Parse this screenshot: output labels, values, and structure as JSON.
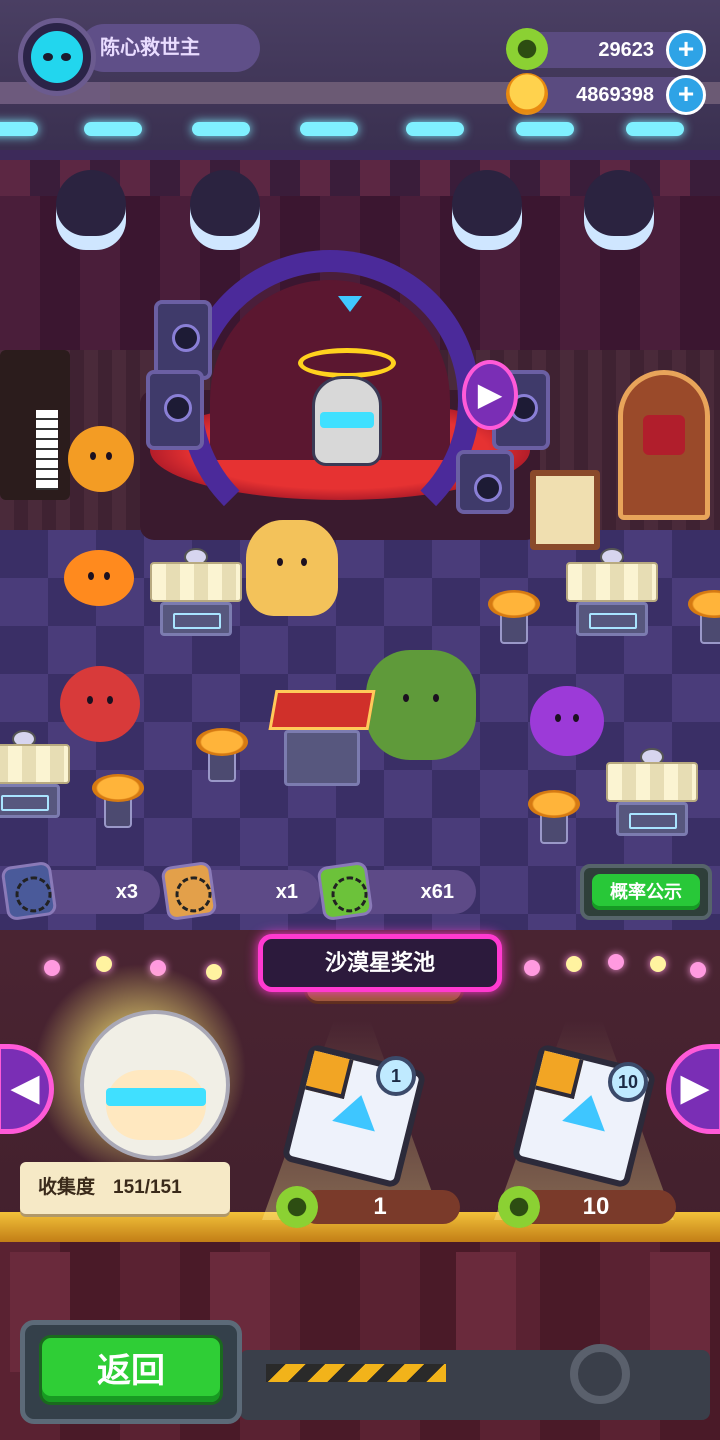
{
  "player": {
    "name": "陈心救世主",
    "avatar_icon": "cat-face-icon",
    "avatar_color": "#22d6ee"
  },
  "currencies": [
    {
      "icon": "green-gear-token-icon",
      "amount": "29623"
    },
    {
      "icon": "golden-planet-coin-icon",
      "amount": "4869398"
    }
  ],
  "inventory": [
    {
      "icon": "blue-bottle-cap-icon",
      "count": "x3"
    },
    {
      "icon": "orange-bottle-cap-icon",
      "count": "x1"
    },
    {
      "icon": "green-bottle-cap-icon",
      "count": "x61"
    }
  ],
  "buttons": {
    "probability": "概率公示",
    "back": "返回",
    "plus": "+",
    "prev": "◀",
    "next": "▶",
    "stage_next": "▶"
  },
  "pool": {
    "title": "沙漠星奖池",
    "collection_label": "收集度",
    "collection_value": "151/151",
    "draws": [
      {
        "badge": "1",
        "cost": "1"
      },
      {
        "badge": "10",
        "cost": "10"
      }
    ]
  },
  "colors": {
    "accent_pink": "#ff3ad0",
    "button_green": "#2fce36",
    "plus_blue": "#2ea3e6"
  }
}
